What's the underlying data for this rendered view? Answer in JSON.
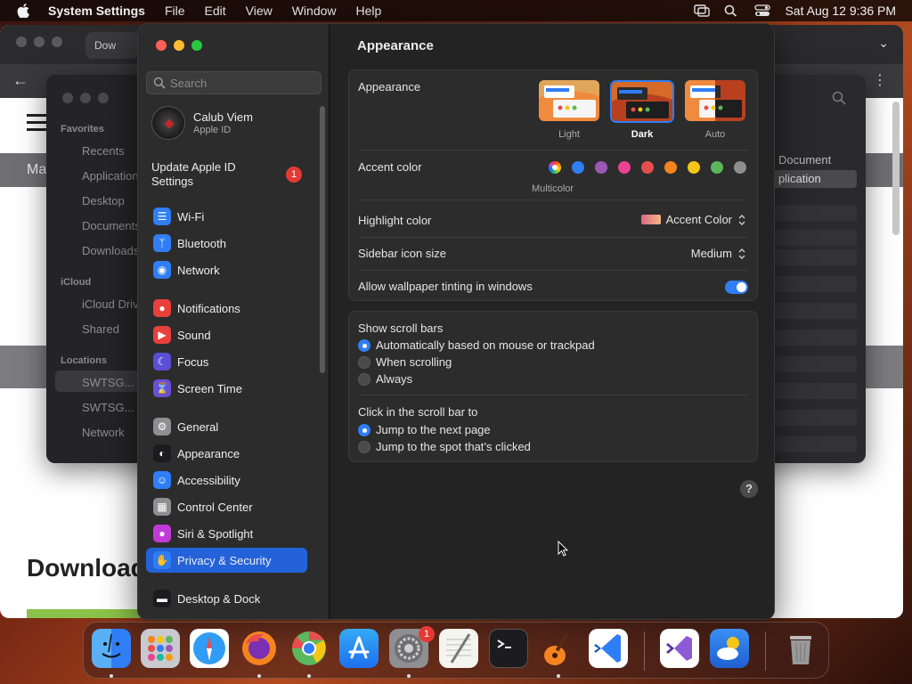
{
  "menubar": {
    "app_name": "System Settings",
    "items": [
      "File",
      "Edit",
      "View",
      "Window",
      "Help"
    ],
    "clock": "Sat Aug 12  9:36 PM"
  },
  "browser": {
    "tab_label": "Dow",
    "headline": "Download"
  },
  "finder": {
    "sections": {
      "favorites": "Favorites",
      "icloud": "iCloud",
      "locations": "Locations"
    },
    "favorites": [
      "Recents",
      "Applications",
      "Desktop",
      "Documents",
      "Downloads"
    ],
    "icloud_items": [
      "iCloud Drive",
      "Shared"
    ],
    "locations": [
      "SWTSG...",
      "SWTSG...",
      "Network"
    ],
    "right_doc": "Document",
    "right_sel": "plication",
    "sidebar_partial_ma": "Ma"
  },
  "settings": {
    "search_placeholder": "Search",
    "account": {
      "name": "Calub Viem",
      "subtitle": "Apple ID"
    },
    "update": {
      "label": "Update Apple ID Settings",
      "badge": "1"
    },
    "nav": [
      {
        "label": "Wi-Fi",
        "icon": "wifi-icon",
        "color": "#2f7ef5"
      },
      {
        "label": "Bluetooth",
        "icon": "bluetooth-icon",
        "color": "#2f7ef5"
      },
      {
        "label": "Network",
        "icon": "network-globe-icon",
        "color": "#2f7ef5"
      },
      {
        "label": "Notifications",
        "icon": "notifications-bell-icon",
        "color": "#e8403a"
      },
      {
        "label": "Sound",
        "icon": "speaker-icon",
        "color": "#e8403a"
      },
      {
        "label": "Focus",
        "icon": "moon-icon",
        "color": "#5b4fd6"
      },
      {
        "label": "Screen Time",
        "icon": "hourglass-icon",
        "color": "#6a4fd6"
      },
      {
        "label": "General",
        "icon": "gear-icon",
        "color": "#8e8e93"
      },
      {
        "label": "Appearance",
        "icon": "appearance-icon",
        "color": "#1c1c1e"
      },
      {
        "label": "Accessibility",
        "icon": "accessibility-icon",
        "color": "#2f7ef5"
      },
      {
        "label": "Control Center",
        "icon": "control-center-icon",
        "color": "#8e8e93"
      },
      {
        "label": "Siri & Spotlight",
        "icon": "siri-icon",
        "color": "#c03ad6"
      },
      {
        "label": "Privacy & Security",
        "icon": "hand-icon",
        "color": "#2f7ef5"
      },
      {
        "label": "Desktop & Dock",
        "icon": "dock-icon",
        "color": "#1c1c1e"
      }
    ],
    "selected_nav": "Privacy & Security",
    "content": {
      "title": "Appearance",
      "appearance_label": "Appearance",
      "modes": [
        "Light",
        "Dark",
        "Auto"
      ],
      "selected_mode": "Dark",
      "accent_label": "Accent color",
      "accent_colors": [
        "#cccccc",
        "#2f7ef5",
        "#9b59b6",
        "#e84393",
        "#e84d4d",
        "#f5841f",
        "#f5c518",
        "#5cb85c",
        "#8e8e8e"
      ],
      "accent_multicolor_label": "Multicolor",
      "highlight_label": "Highlight color",
      "highlight_value": "Accent Color",
      "sidebar_icon_label": "Sidebar icon size",
      "sidebar_icon_value": "Medium",
      "wallpaper_tint_label": "Allow wallpaper tinting in windows",
      "wallpaper_tint_on": true,
      "scroll_bars_label": "Show scroll bars",
      "scroll_options": [
        "Automatically based on mouse or trackpad",
        "When scrolling",
        "Always"
      ],
      "scroll_selected": 0,
      "click_label": "Click in the scroll bar to",
      "click_options": [
        "Jump to the next page",
        "Jump to the spot that’s clicked"
      ],
      "click_selected": 0,
      "help": "?"
    }
  },
  "dock": {
    "apps": [
      "Finder",
      "Launchpad",
      "Safari",
      "Firefox",
      "Chrome",
      "App Store",
      "System Settings",
      "TextEdit",
      "Terminal",
      "GarageBand",
      "Visual Studio Code",
      "Visual Studio",
      "Weather",
      "Trash"
    ],
    "settings_badge": "1"
  }
}
